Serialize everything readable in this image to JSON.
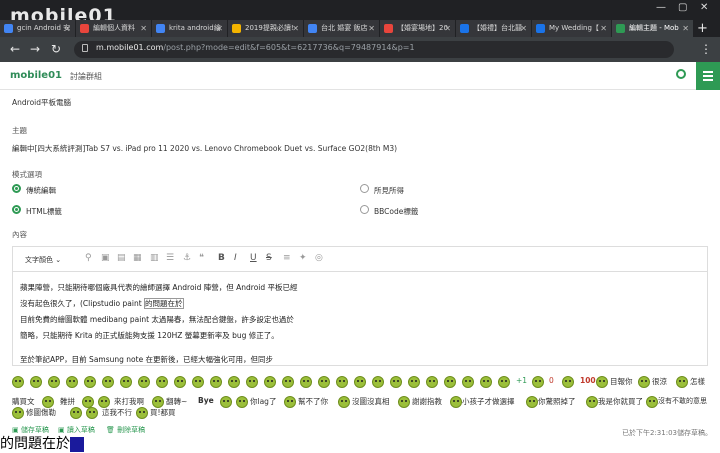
{
  "browser": {
    "logo": "mobile01",
    "tabs": [
      {
        "label": "gcin Android 安",
        "fav": "#4285f4"
      },
      {
        "label": "編輯個人資料",
        "fav": "#e8453c"
      },
      {
        "label": "krita android繪",
        "fav": "#4285f4"
      },
      {
        "label": "2019提親必讀!",
        "fav": "#f4b400"
      },
      {
        "label": "台北 婚宴 飯店",
        "fav": "#4285f4"
      },
      {
        "label": "【婚宴場地】20",
        "fav": "#e8453c"
      },
      {
        "label": "【婚禮】台北囍",
        "fav": "#1a73e8"
      },
      {
        "label": "My Wedding【",
        "fav": "#1a73e8"
      },
      {
        "label": "編輯主題 - Mob",
        "fav": "#2e9a54"
      }
    ],
    "url_host": "m.mobile01.com",
    "url_path": "/post.php?mode=edit&f=605&t=6217736&q=79487914&p=1"
  },
  "site": {
    "brand": "mobile01",
    "forum_link": "討論群組"
  },
  "form": {
    "category": "Android平板電腦",
    "subject_label": "主題",
    "subject_value": "編輯中[四大系統評測]Tab S7 vs. iPad pro 11 2020 vs. Lenovo Chromebook Duet vs. Surface GO2(8th M3)",
    "mode_label": "模式選項",
    "modes": {
      "traditional": "傳統編輯",
      "wysiwyg": "所見所得",
      "html": "HTML標籤",
      "bbcode": "BBCode標籤"
    },
    "content_label": "內容",
    "toolbar_text_color": "文字顏色"
  },
  "editor": {
    "line1": "蘋果陣營，只能期待哪個廠具代表的繪師選擇 Android 陣營，但 Android 平板已經",
    "line2a": "沒有起色很久了，(Clipstudio paint ",
    "line2b": "的問題在於",
    "line3": "目前免費的繪圖軟體 medibang paint 太過陽春，無法配合鍵盤，許多設定也過於",
    "line4": "簡略，只能期待 Krita 的正式版能夠支援 120HZ 螢幕更新率及 bug 修正了。",
    "line5": "至於筆記APP，目前 Samsung note 在更新後，已經大幅強化可用，但同步"
  },
  "emoticons": {
    "row1_labels": [
      "+1",
      "0",
      "100",
      "目報你",
      "很涼",
      "怎樣"
    ],
    "row2_labels": [
      "購買文",
      "難拼",
      "來打我啊",
      "翻轉~",
      "Bye",
      "你lag了",
      "幫不了你",
      "沒圖沒真相",
      "謝謝指教",
      "小孩子才做選擇",
      "你驚照掉了",
      "我是你就買了",
      "沒有不敢的意思"
    ],
    "row3_labels": [
      "修圖傷勒",
      "這我不行",
      "買!都買"
    ]
  },
  "footer": {
    "save_draft": "儲存草稿",
    "load_draft": "讀入草稿",
    "delete_draft": "刪除草稿",
    "status": "已於下午2:31:03儲存草稿。"
  },
  "ime_preedit": "的問題在於"
}
